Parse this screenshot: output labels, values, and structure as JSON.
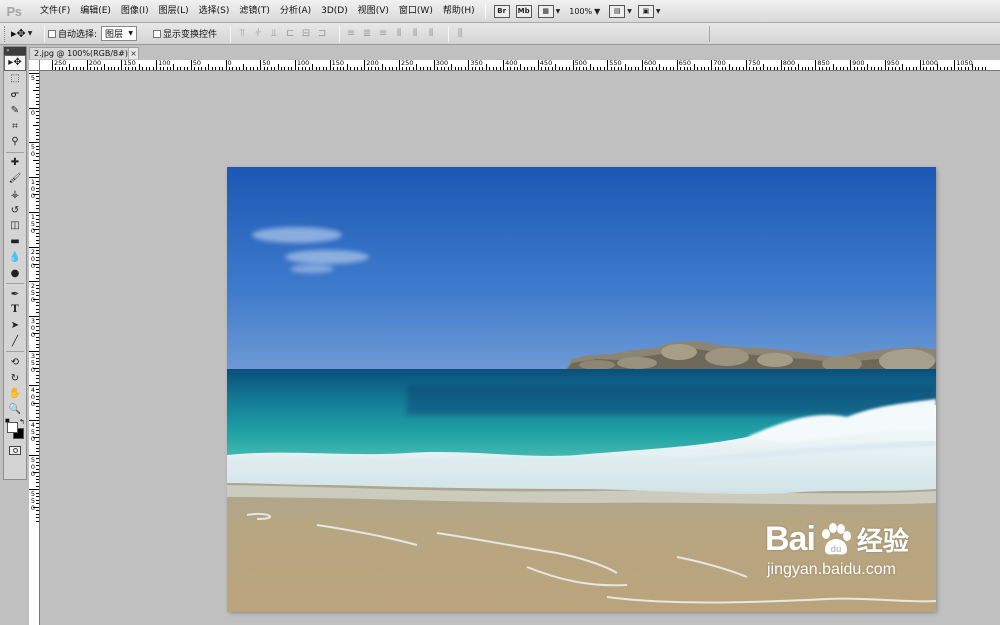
{
  "app": {
    "logo": "Ps"
  },
  "menu": {
    "items": [
      "文件(F)",
      "编辑(E)",
      "图像(I)",
      "图层(L)",
      "选择(S)",
      "滤镜(T)",
      "分析(A)",
      "3D(D)",
      "视图(V)",
      "窗口(W)",
      "帮助(H)"
    ]
  },
  "menubar_tools": {
    "bridge_label": "Br",
    "minibridge_label": "Mb",
    "zoom_value": "100%"
  },
  "options": {
    "auto_select_label": "自动选择:",
    "auto_select_checked": false,
    "auto_select_target": "图层",
    "show_transform_label": "显示变换控件",
    "show_transform_checked": false
  },
  "document": {
    "tab_title": "2.jpg @ 100%(RGB/8#)",
    "close_label": "×"
  },
  "ruler": {
    "h_labels": [
      "250",
      "200",
      "150",
      "100",
      "50",
      "0",
      "50",
      "100",
      "150",
      "200",
      "250",
      "300",
      "350",
      "400",
      "450",
      "500",
      "550",
      "600",
      "650",
      "700",
      "750",
      "800",
      "850",
      "900",
      "950",
      "1000",
      "1050"
    ],
    "v_labels": [
      "5",
      "0",
      "5 0",
      "1 0 0",
      "1 5 0",
      "2 0 0",
      "2 5 0",
      "3 0 0",
      "3 5 0",
      "4 0 0",
      "4 5 0",
      "5 0 0",
      "5 5 0"
    ]
  },
  "tools": [
    "move-tool",
    "marquee-tool",
    "lasso-tool",
    "quick-selection-tool",
    "crop-tool",
    "eyedropper-tool",
    "healing-brush-tool",
    "brush-tool",
    "clone-stamp-tool",
    "history-brush-tool",
    "eraser-tool",
    "gradient-tool",
    "blur-tool",
    "dodge-tool",
    "pen-tool",
    "type-tool",
    "path-selection-tool",
    "rectangle-tool",
    "3d-rotate-tool",
    "3d-orbit-tool",
    "hand-tool",
    "zoom-tool"
  ],
  "colors": {
    "foreground": "#ffffff",
    "background": "#000000",
    "sky_top": "#1f5cb4",
    "sky_horizon": "#5b8fd3",
    "sea_deep": "#0b4d80",
    "sea_turquoise": "#1c9aa0",
    "sand": "#b8a37f"
  },
  "watermark": {
    "brand": "Bai",
    "brand_suffix": "经验",
    "url": "jingyan.baidu.com"
  }
}
